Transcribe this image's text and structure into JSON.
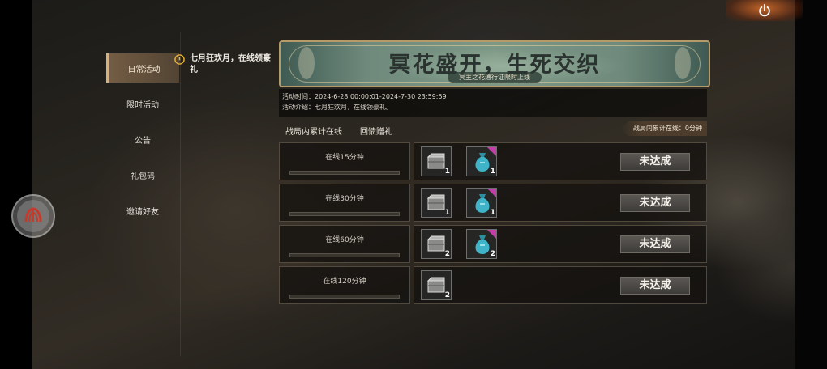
{
  "sidebar": {
    "items": [
      {
        "label": "日常活动",
        "active": true
      },
      {
        "label": "限时活动",
        "active": false
      },
      {
        "label": "公告",
        "active": false
      },
      {
        "label": "礼包码",
        "active": false
      },
      {
        "label": "邀请好友",
        "active": false
      }
    ]
  },
  "notice": {
    "icon": "warning-icon",
    "text": "七月狂欢月，在线领豪礼"
  },
  "banner": {
    "title": "冥花盛开，生死交织",
    "subtitle": "冥主之花通行证限时上线"
  },
  "info": {
    "time": "活动时间：2024-6-28 00:00:01-2024-7-30 23:59:59",
    "intro": "活动介绍：七月狂欢月，在线领豪礼。"
  },
  "tabs": [
    {
      "label": "战局内累计在线"
    },
    {
      "label": "回馈赠礼"
    }
  ],
  "online_badge": "战局内累计在线：0分钟",
  "rows": [
    {
      "label": "在线15分钟",
      "progress": 0,
      "rewards": [
        {
          "icon": "crate-icon",
          "count": "1"
        },
        {
          "icon": "bag-icon",
          "count": "1"
        }
      ],
      "status": "未达成"
    },
    {
      "label": "在线30分钟",
      "progress": 0,
      "rewards": [
        {
          "icon": "crate-icon",
          "count": "1"
        },
        {
          "icon": "bag-icon",
          "count": "1"
        }
      ],
      "status": "未达成"
    },
    {
      "label": "在线60分钟",
      "progress": 0,
      "rewards": [
        {
          "icon": "crate-icon",
          "count": "2"
        },
        {
          "icon": "bag-icon",
          "count": "2"
        }
      ],
      "status": "未达成"
    },
    {
      "label": "在线120分钟",
      "progress": 0,
      "rewards": [
        {
          "icon": "crate-icon",
          "count": "2"
        }
      ],
      "status": "未达成"
    }
  ],
  "colors": {
    "accent": "#d7b07a",
    "rare_corner": "#c43ea8",
    "bag": "#3fb3c8"
  }
}
